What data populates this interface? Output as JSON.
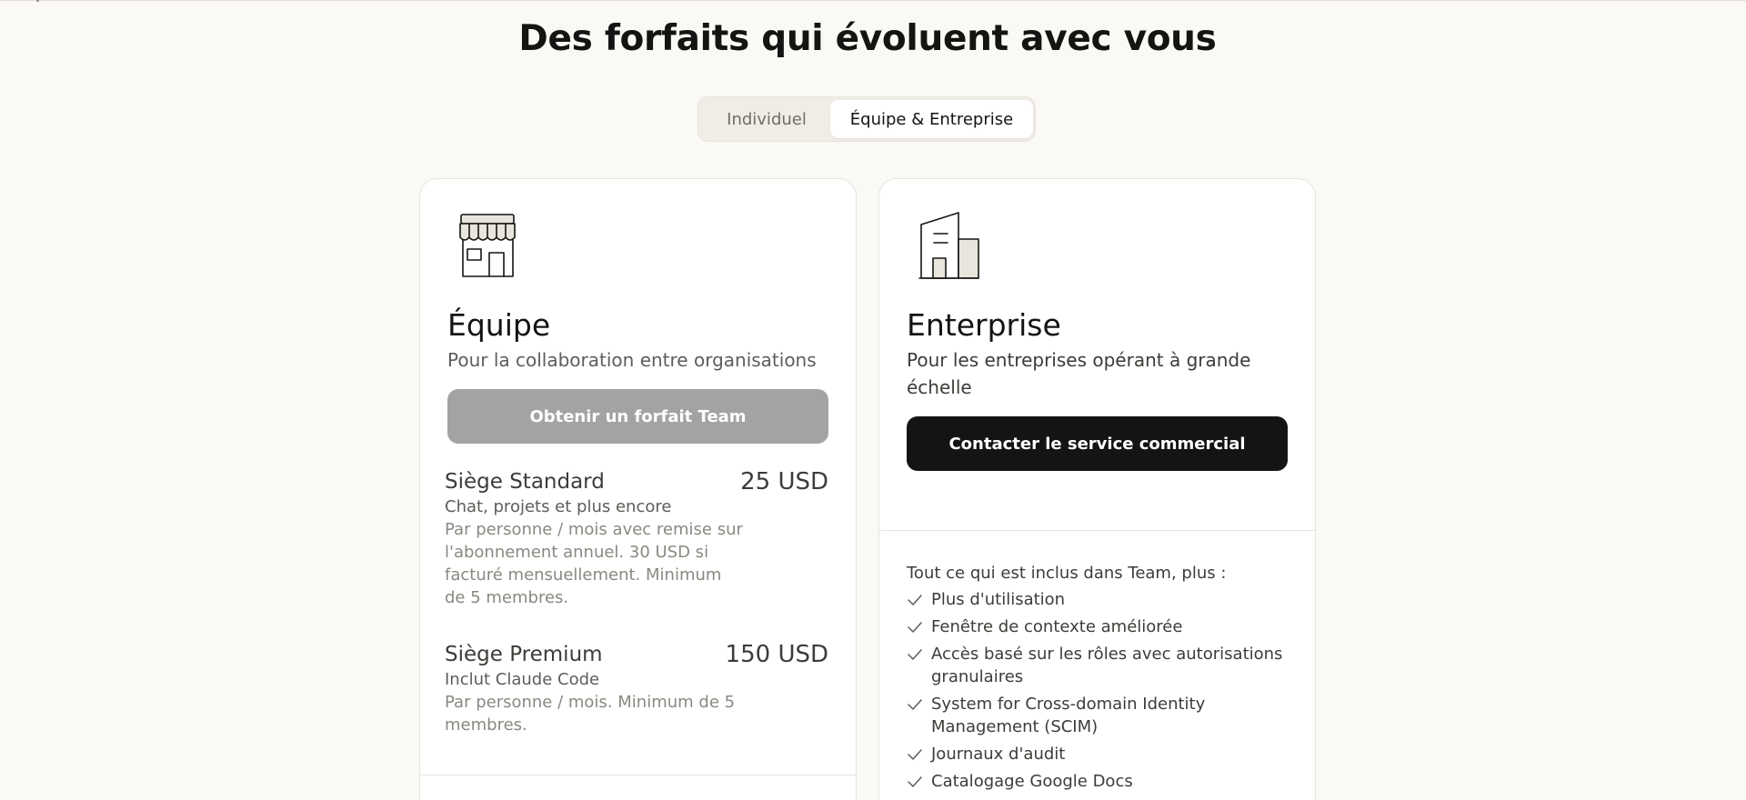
{
  "page": {
    "title": "Des forfaits qui évoluent avec vous"
  },
  "toggle": {
    "options": [
      "Individuel",
      "Équipe & Entreprise"
    ],
    "selected": "Équipe & Entreprise"
  },
  "team": {
    "icon": "storefront-icon",
    "title": "Équipe",
    "subtitle": "Pour la collaboration entre organisations",
    "cta_label": "Obtenir un forfait Team",
    "seats": [
      {
        "name": "Siège Standard",
        "price": "25 USD",
        "desc": "Chat, projets et plus encore",
        "note": "Par personne / mois avec remise sur l'abonnement annuel. 30 USD si facturé mensuellement. Minimum de 5 membres."
      },
      {
        "name": "Siège Premium",
        "price": "150 USD",
        "desc": "Inclut Claude Code",
        "note": "Par personne / mois. Minimum de 5 membres."
      }
    ]
  },
  "enterprise": {
    "icon": "building-icon",
    "title": "Enterprise",
    "subtitle": "Pour les entreprises opérant à grande échelle",
    "cta_label": "Contacter le service commercial",
    "features_heading": "Tout ce qui est inclus dans Team, plus :",
    "features": [
      "Plus d'utilisation",
      "Fenêtre de contexte améliorée",
      "Accès basé sur les rôles avec autorisations granulaires",
      "System for Cross-domain Identity Management (SCIM)",
      "Journaux d'audit",
      "Catalogage Google Docs"
    ]
  },
  "colors": {
    "background": "#faf9f5",
    "card": "#ffffff",
    "primary_button": "#141413",
    "disabled_button": "#a3a3a3",
    "icon_fill": "#e8e6dc"
  }
}
